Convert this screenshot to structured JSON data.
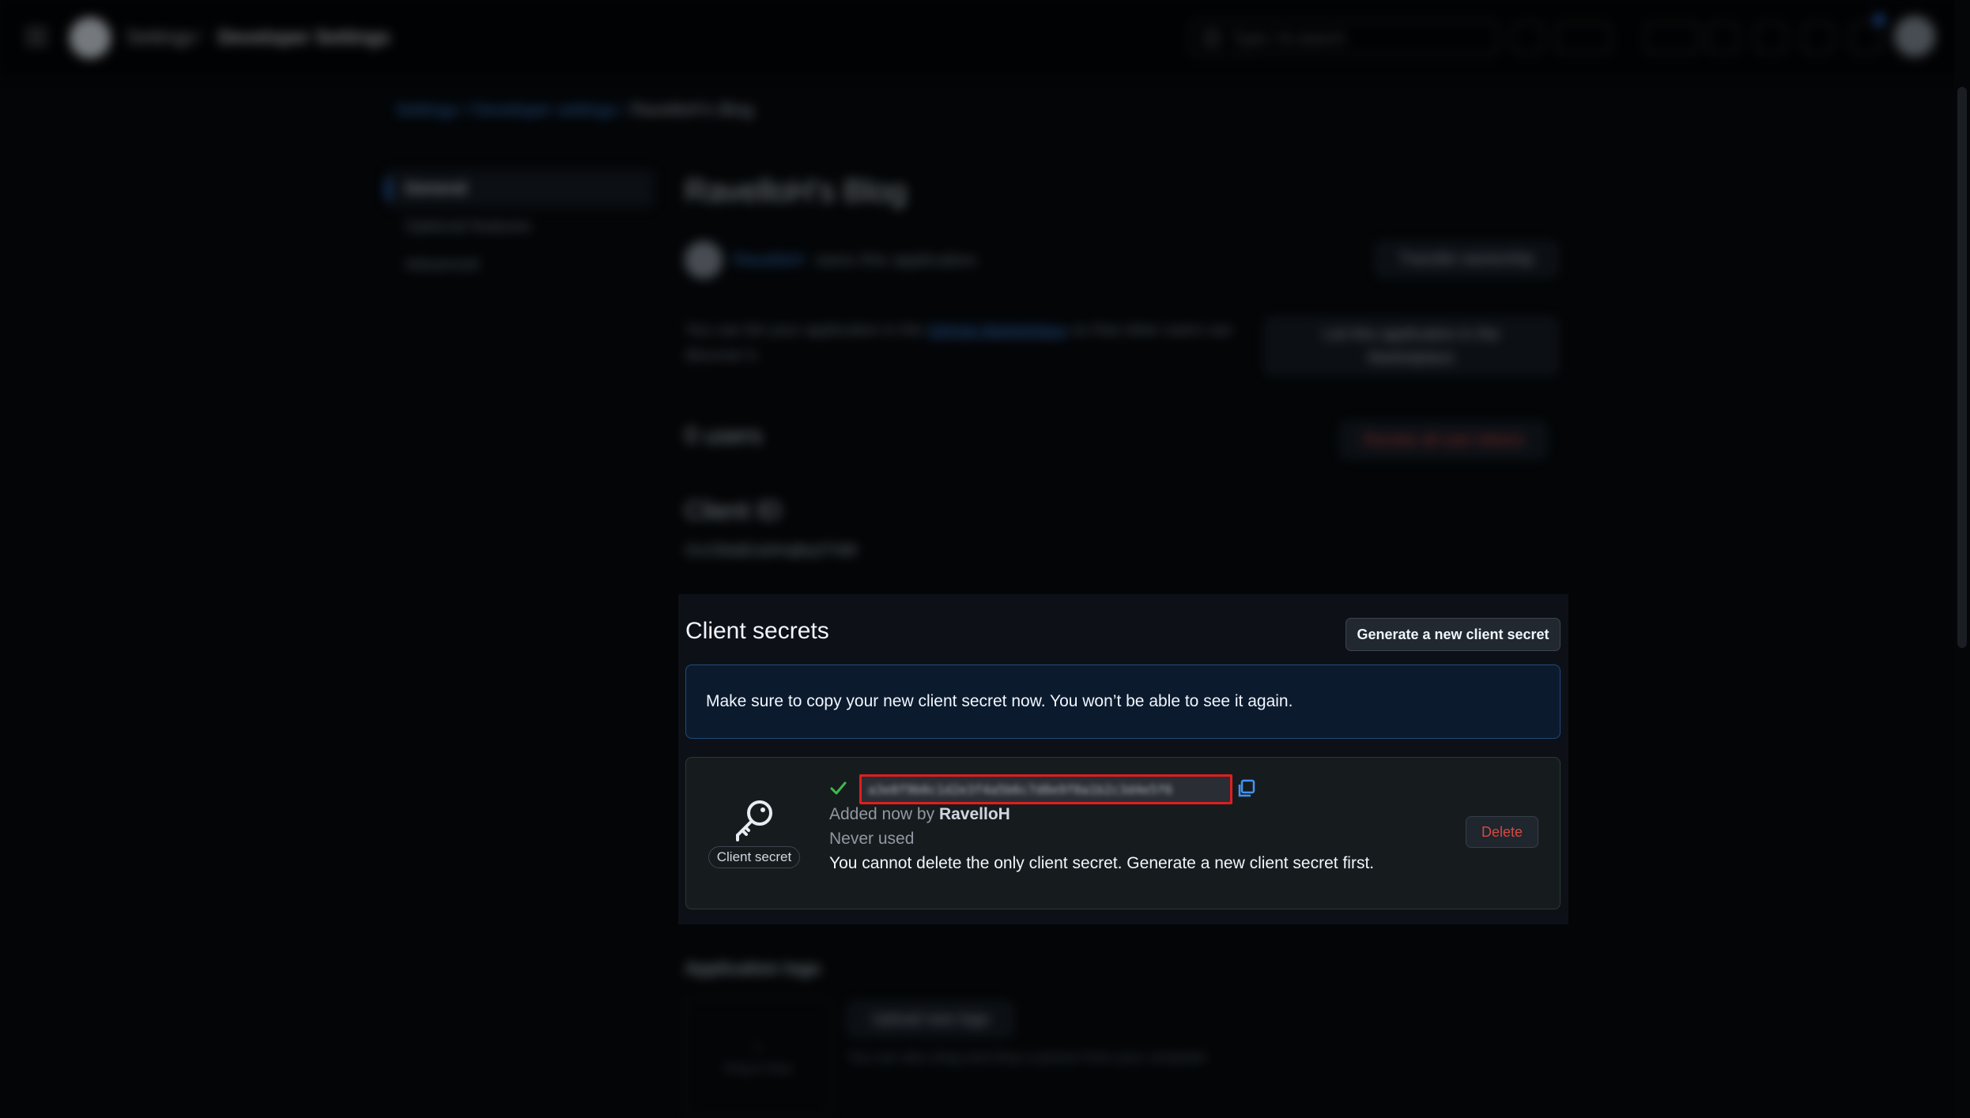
{
  "topbar": {
    "crumb1": "Settings",
    "separator": "/",
    "crumb2": "Developer Settings",
    "search_placeholder": "Type / to search"
  },
  "breadcrumbs": {
    "settings": "Settings",
    "sep": "/",
    "developer": "Developer settings",
    "current": "RavelloH's Blog"
  },
  "sidebar": {
    "items": [
      {
        "label": "General"
      },
      {
        "label": "Optional features"
      },
      {
        "label": "Advanced"
      }
    ]
  },
  "app": {
    "title": "RavelloH's Blog",
    "owner": "RavelloH",
    "owner_suffix": "owns this application.",
    "transfer_button": "Transfer ownership",
    "marketplace_text_a": "You can list your application in the",
    "marketplace_link": "GitHub Marketplace",
    "marketplace_text_b": "so that other users can discover it.",
    "marketplace_button": "List this application in the Marketplace",
    "users": "0 users",
    "revoke_button": "Revoke all user tokens",
    "client_id_heading": "Client ID",
    "client_id": "Ov23liaB2a0HqBq3TNl8"
  },
  "client_secrets": {
    "title": "Client secrets",
    "generate_button": "Generate a new client secret",
    "flash_message": "Make sure to copy your new client secret now. You won’t be able to see it again.",
    "secret": {
      "badge_label": "Client secret",
      "value": "a3e8f9b0c1d2e3f4a5b6c7d8e9f0a1b2c3d4e5f6",
      "added_prefix": "Added now by",
      "added_by": "RavelloH",
      "usage": "Never used",
      "note": "You cannot delete the only client secret. Generate a new client secret first.",
      "delete_button": "Delete"
    }
  },
  "logo_section": {
    "heading": "Application logo",
    "drop_label": "Drag & drop",
    "upload_button": "Upload new logo",
    "hint": "You can also drag and drop a picture from your computer."
  },
  "colors": {
    "accent": "#2f81f7",
    "danger": "#f85149",
    "success": "#3fb950",
    "highlight_box": "#e01e1e"
  }
}
